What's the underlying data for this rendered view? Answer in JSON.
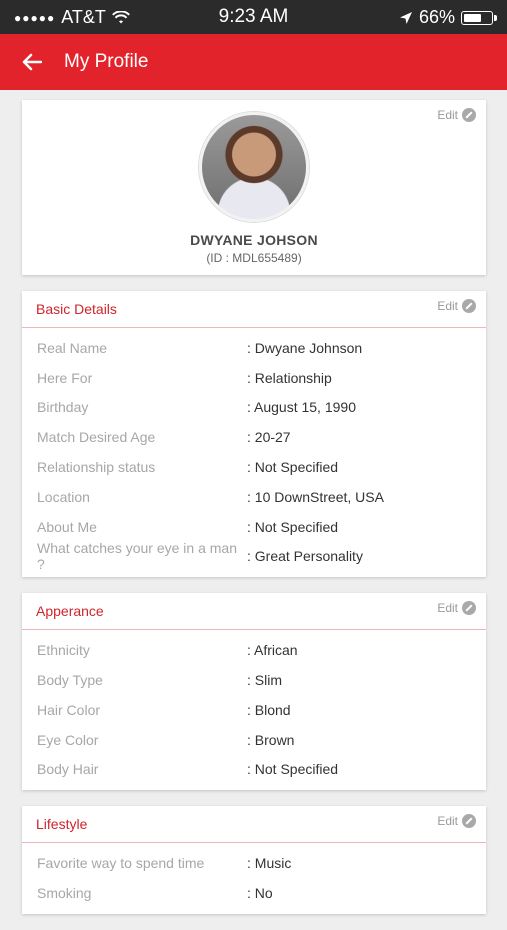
{
  "status_bar": {
    "signal_dots": "●●●●●",
    "carrier": "AT&T",
    "time": "9:23 AM",
    "battery_percent": "66%",
    "battery_level": 0.66
  },
  "app_bar": {
    "title": "My Profile"
  },
  "profile": {
    "edit_label": "Edit",
    "name": "DWYANE JOHSON",
    "id_text": "(ID : MDL655489)"
  },
  "sections": [
    {
      "title": "Basic Details",
      "edit_label": "Edit",
      "rows": [
        {
          "label": "Real Name",
          "value": ": Dwyane Johnson"
        },
        {
          "label": "Here For",
          "value": ": Relationship"
        },
        {
          "label": "Birthday",
          "value": ": August 15, 1990"
        },
        {
          "label": "Match Desired Age",
          "value": ": 20-27"
        },
        {
          "label": "Relationship status",
          "value": ": Not Specified"
        },
        {
          "label": "Location",
          "value": ": 10 DownStreet, USA"
        },
        {
          "label": "About Me",
          "value": ": Not Specified"
        },
        {
          "label": "What catches your eye in a man ?",
          "value": ": Great Personality"
        }
      ]
    },
    {
      "title": "Apperance",
      "edit_label": "Edit",
      "rows": [
        {
          "label": "Ethnicity",
          "value": ": African"
        },
        {
          "label": "Body Type",
          "value": ": Slim"
        },
        {
          "label": "Hair Color",
          "value": ": Blond"
        },
        {
          "label": "Eye Color",
          "value": ": Brown"
        },
        {
          "label": "Body Hair",
          "value": ": Not Specified"
        }
      ]
    },
    {
      "title": "Lifestyle",
      "edit_label": "Edit",
      "rows": [
        {
          "label": "Favorite way to spend time",
          "value": ": Music"
        },
        {
          "label": "Smoking",
          "value": ": No"
        }
      ]
    }
  ],
  "colors": {
    "accent": "#e3232b",
    "section_title": "#d0242b",
    "status_bar": "#2b2b2b"
  }
}
